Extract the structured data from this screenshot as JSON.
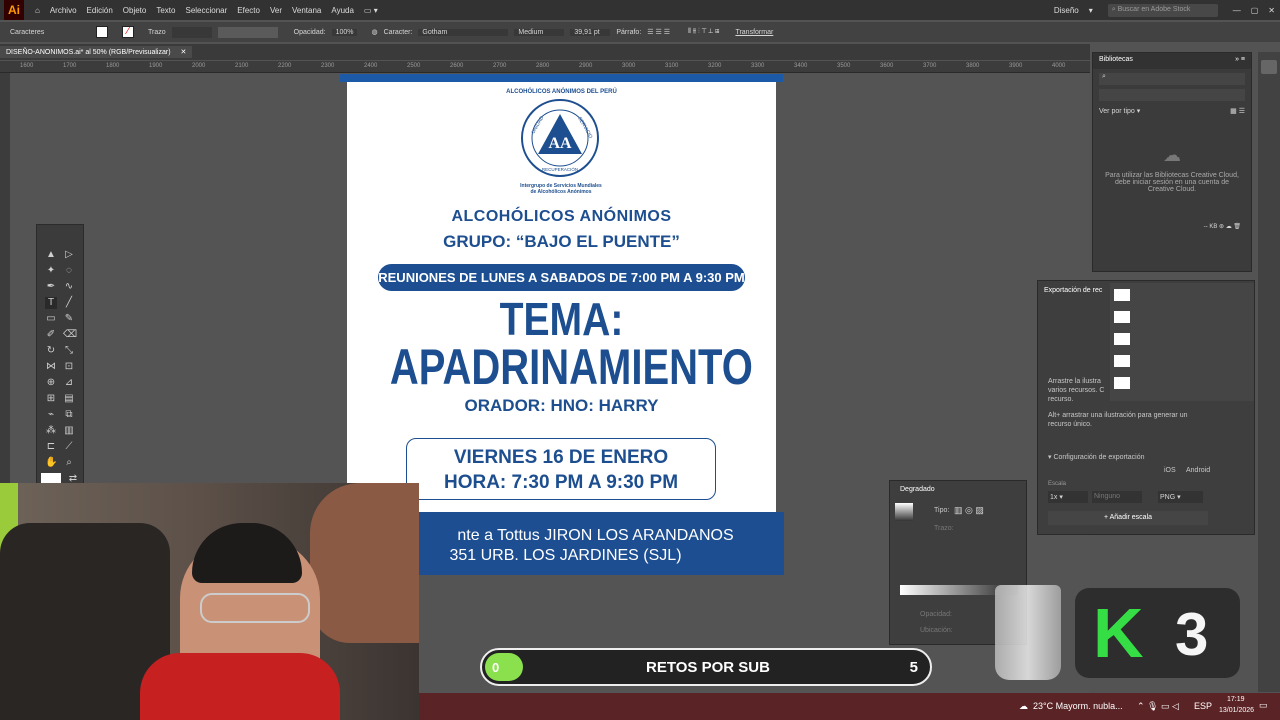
{
  "app": {
    "logo": "Ai"
  },
  "menu": [
    "Archivo",
    "Edición",
    "Objeto",
    "Texto",
    "Seleccionar",
    "Efecto",
    "Ver",
    "Ventana",
    "Ayuda"
  ],
  "workspace": "Diseño",
  "search_placeholder": "Buscar en Adobe Stock",
  "control": {
    "label": "Caracteres",
    "stroke": "Trazo",
    "opacity_label": "Opacidad:",
    "opacity": "100%",
    "char_label": "Caracter:",
    "font": "Gotham",
    "weight": "Medium",
    "size": "39,91 pt",
    "paragraph": "Párrafo:",
    "transform": "Transformar"
  },
  "tab": "DISEÑO-ANONIMOS.ai* al 50% (RGB/Previsualizar)",
  "ruler": [
    "1600",
    "1700",
    "1800",
    "1900",
    "2000",
    "2100",
    "2200",
    "2300",
    "2400",
    "2500",
    "2600",
    "2700",
    "2800",
    "2900",
    "3000",
    "3100",
    "3200",
    "3300",
    "3400",
    "3500",
    "3600",
    "3700",
    "3800",
    "3900",
    "4000"
  ],
  "poster": {
    "org": "ALCOHÓLICOS ANÓNIMOS DEL PERÚ",
    "logo_text": "AA",
    "logo_ring_left": "UNIDAD",
    "logo_ring_right": "SERVICIO",
    "logo_ring_bottom": "RECUPERACIÓN",
    "subtitle1": "Intergrupo de Servicios Mundiales",
    "subtitle2": "de Alcohólicos Anónimos",
    "heading1": "ALCOHÓLICOS ANÓNIMOS",
    "heading2": "GRUPO: “BAJO EL PUENTE”",
    "meetings": "REUNIONES DE LUNES A SABADOS DE 7:00 PM A 9:30 PM",
    "tema": "TEMA:",
    "topic": "APADRINAMIENTO",
    "speaker": "ORADOR: HNO: HARRY",
    "date": "VIERNES 16 DE ENERO",
    "time": "HORA: 7:30 PM A 9:30 PM",
    "address1": "nte a Tottus JIRON LOS ARANDANOS",
    "address2": "351 URB. LOS JARDINES (SJL)"
  },
  "libraries": {
    "title": "Bibliotecas",
    "view": "Ver por tipo",
    "message": "Para utilizar las Bibliotecas Creative Cloud, debe iniciar sesión en una cuenta de Creative Cloud.",
    "size": "-- KB"
  },
  "export": {
    "title": "Exportación de rec",
    "hint1": "Arrastre la ilustra varios recursos. C recurso.",
    "hint2": "Alt+ arrastrar una ilustración para generar un recurso único.",
    "config": "Configuración de exportación",
    "ios": "iOS",
    "android": "Android",
    "scale_label": "Escala",
    "scale": "1x",
    "suffix_placeholder": "Ninguno",
    "format_label": "Formato",
    "format": "PNG",
    "add_scale": "Añadir escala"
  },
  "gradient": {
    "title": "Degradado",
    "type": "Tipo:",
    "stroke": "Trazo:",
    "opacity": "Opacidad:",
    "location": "Ubicación:"
  },
  "stream": {
    "retos_left": "0",
    "retos_title": "RETOS POR SUB",
    "retos_right": "5",
    "retos_progress": 0.0,
    "k_label": "K",
    "k_count": "3"
  },
  "taskbar": {
    "weather": "23°C  Mayorm. nubla...",
    "lang": "ESP",
    "time": "17:19",
    "date": "13/01/2026"
  },
  "colors": {
    "navy": "#1d4e8f",
    "accent_green": "#8be04e",
    "ai_orange": "#ff9a00"
  }
}
